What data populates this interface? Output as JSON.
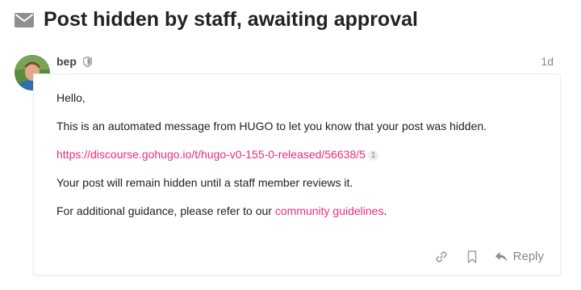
{
  "topic": {
    "title": "Post hidden by staff, awaiting approval",
    "icon": "envelope-icon"
  },
  "post": {
    "username": "bep",
    "user_badge_icon": "shield-icon",
    "date": "1d",
    "greeting": "Hello,",
    "line1": "This is an automated message from HUGO to let you know that your post was hidden.",
    "link_url": "https://discourse.gohugo.io/t/hugo-v0-155-0-released/56638/5",
    "link_clicks": "1",
    "line3": "Your post will remain hidden until a staff member reviews it.",
    "line4_prefix": "For additional guidance, please refer to our ",
    "guidelines_link": "community guidelines",
    "line4_suffix": "."
  },
  "actions": {
    "copy_link_icon": "link-icon",
    "bookmark_icon": "bookmark-icon",
    "reply_icon": "reply-arrow-icon",
    "reply_label": "Reply"
  },
  "colors": {
    "link": "#e92e78",
    "muted": "#888888",
    "title": "#222222"
  }
}
